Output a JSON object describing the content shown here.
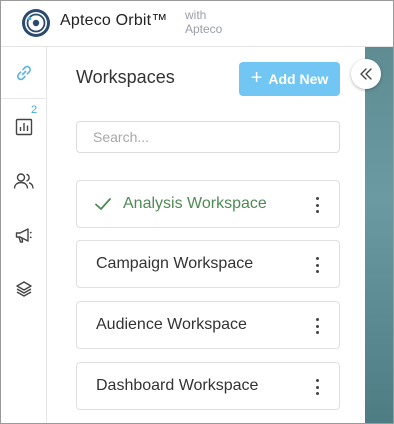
{
  "header": {
    "brand": "Apteco Orbit™",
    "with_label": "with",
    "with_company": "Apteco"
  },
  "rail": {
    "items": [
      {
        "icon": "link-icon",
        "active": true
      },
      {
        "icon": "bar-chart-icon",
        "badge": "2"
      },
      {
        "icon": "people-icon"
      },
      {
        "icon": "megaphone-icon"
      },
      {
        "icon": "layers-icon"
      }
    ]
  },
  "panel": {
    "title": "Workspaces",
    "add_new_label": "Add New",
    "search_placeholder": "Search...",
    "workspaces": [
      {
        "label": "Analysis Workspace",
        "selected": true
      },
      {
        "label": "Campaign Workspace",
        "selected": false
      },
      {
        "label": "Audience Workspace",
        "selected": false
      },
      {
        "label": "Dashboard Workspace",
        "selected": false
      }
    ]
  },
  "colors": {
    "accent": "#72c6f4",
    "selected_text": "#4f8a55",
    "badge": "#3ea9e3"
  }
}
